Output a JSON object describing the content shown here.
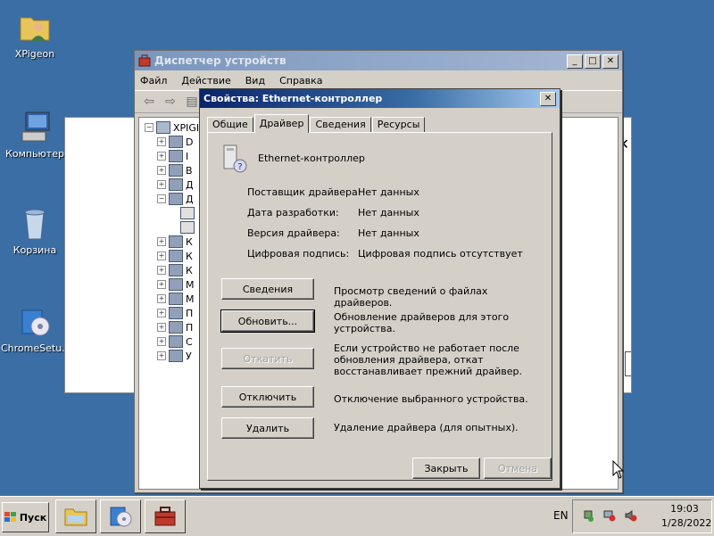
{
  "desktop": {
    "icons": [
      {
        "label": "XPigeon"
      },
      {
        "label": "Компьютер"
      },
      {
        "label": "Корзина"
      },
      {
        "label": "ChromeSetu..."
      }
    ]
  },
  "device_manager": {
    "title": "Диспетчер устройств",
    "menu": [
      "Файл",
      "Действие",
      "Вид",
      "Справка"
    ],
    "tree": {
      "root_label": "XPIGI",
      "items": [
        "D",
        "I",
        "B",
        "Д",
        "Д",
        "",
        "",
        "К",
        "К",
        "К",
        "М",
        "М",
        "П",
        "П",
        "С",
        "У"
      ]
    }
  },
  "dialog": {
    "title": "Свойства: Ethernet-контроллер",
    "tabs": [
      "Общие",
      "Драйвер",
      "Сведения",
      "Ресурсы"
    ],
    "active_tab": "Драйвер",
    "device_name": "Ethernet-контроллер",
    "properties": [
      {
        "label": "Поставщик драйвера:",
        "value": "Нет данных"
      },
      {
        "label": "Дата разработки:",
        "value": "Нет данных"
      },
      {
        "label": "Версия драйвера:",
        "value": "Нет данных"
      },
      {
        "label": "Цифровая подпись:",
        "value": "Цифровая подпись отсутствует"
      }
    ],
    "actions": [
      {
        "label": "Сведения",
        "desc": "Просмотр сведений о файлах драйверов.",
        "enabled": true
      },
      {
        "label": "Обновить...",
        "desc": "Обновление драйверов для этого устройства.",
        "enabled": true
      },
      {
        "label": "Откатить",
        "desc": "Если устройство не работает после обновления драйвера, откат восстанавливает прежний драйвер.",
        "enabled": false
      },
      {
        "label": "Отключить",
        "desc": "Отключение выбранного устройства.",
        "enabled": true
      },
      {
        "label": "Удалить",
        "desc": "Удаление драйвера (для опытных).",
        "enabled": true
      }
    ],
    "ok_label": "Закрыть",
    "cancel_label": "Отмена"
  },
  "taskbar": {
    "start_label": "Пуск",
    "language": "EN",
    "time": "19:03",
    "date": "1/28/2022"
  }
}
